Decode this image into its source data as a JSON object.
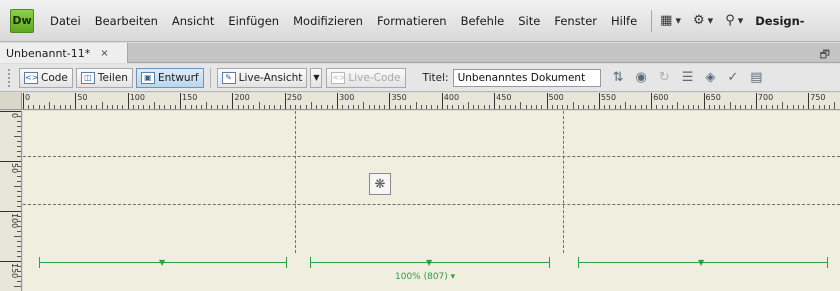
{
  "app": {
    "logo": "Dw",
    "menu": [
      "Datei",
      "Bearbeiten",
      "Ansicht",
      "Einfügen",
      "Modifizieren",
      "Formatieren",
      "Befehle",
      "Site",
      "Fenster",
      "Hilfe"
    ],
    "workspace_label": "Design-",
    "menu_icons": [
      "layout-icon",
      "gear-icon",
      "sitemap-icon"
    ]
  },
  "document_tab": {
    "label": "Unbenannt-11*",
    "close": "×",
    "restore": "🗗"
  },
  "toolbar": {
    "code_label": "Code",
    "split_label": "Teilen",
    "design_label": "Entwurf",
    "live_view_label": "Live-Ansicht",
    "live_code_label": "Live-Code",
    "title_label": "Titel:",
    "title_value": "Unbenanntes Dokument"
  },
  "ruler": {
    "h_labels": [
      "0",
      "50",
      "100",
      "150",
      "200",
      "250",
      "300",
      "350",
      "400",
      "450",
      "500",
      "550",
      "600",
      "650",
      "700",
      "750"
    ],
    "v_labels": [
      "0",
      "50",
      "100",
      "150"
    ]
  },
  "layout": {
    "total_width_label": "100% (807) ▾",
    "column_marker": "▼"
  },
  "colors": {
    "canvas": "#efeedf",
    "width_indicator": "#2f9e44",
    "dw_logo": "#6fb72f"
  }
}
